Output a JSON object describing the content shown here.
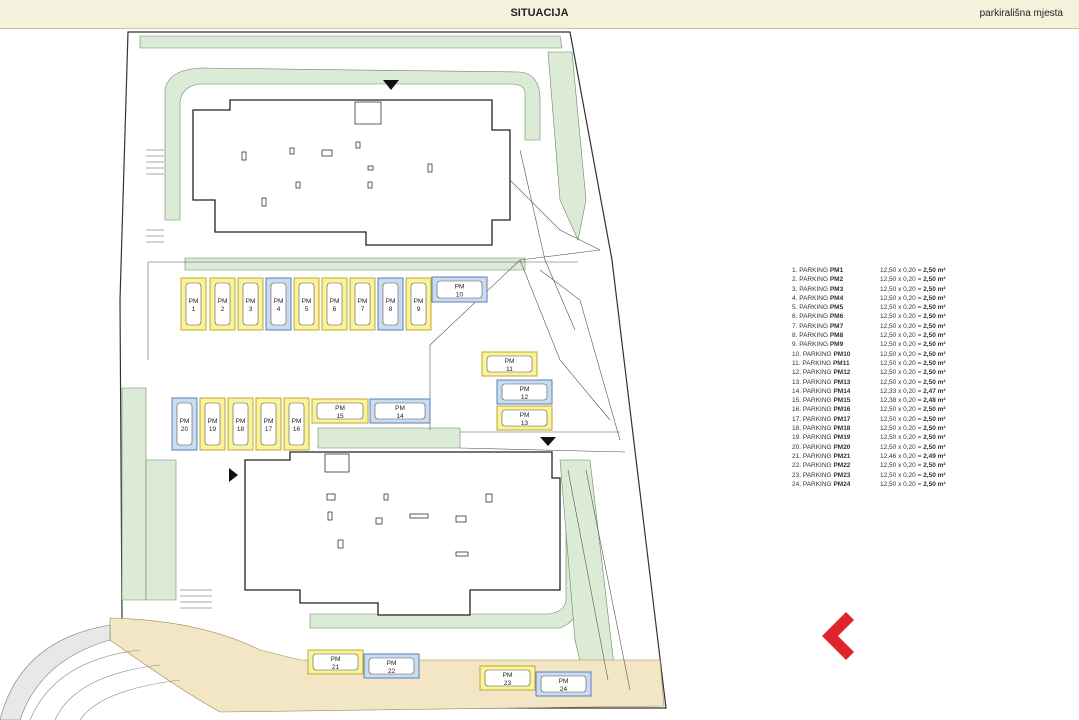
{
  "header": {
    "title": "SITUACIJA",
    "subtitle": "parkirališna mjesta"
  },
  "colors": {
    "green": "#dcebd6",
    "sand": "#f2e6c4",
    "yellow_bay": "#fbf39a",
    "blue_bay": "#c9dcf0",
    "yellow_border": "#b8a93a",
    "blue_border": "#5b7fb6",
    "brand_red": "#e0242c"
  },
  "icons": {
    "logo": "red-chevron-left-icon",
    "entrance": "triangle-marker-icon"
  },
  "bays": [
    {
      "num": "1",
      "color": "yellow"
    },
    {
      "num": "2",
      "color": "yellow"
    },
    {
      "num": "3",
      "color": "yellow"
    },
    {
      "num": "4",
      "color": "blue"
    },
    {
      "num": "5",
      "color": "yellow"
    },
    {
      "num": "6",
      "color": "yellow"
    },
    {
      "num": "7",
      "color": "yellow"
    },
    {
      "num": "8",
      "color": "blue"
    },
    {
      "num": "9",
      "color": "yellow"
    },
    {
      "num": "10",
      "color": "blue"
    },
    {
      "num": "11",
      "color": "yellow"
    },
    {
      "num": "12",
      "color": "blue"
    },
    {
      "num": "13",
      "color": "yellow"
    },
    {
      "num": "14",
      "color": "blue"
    },
    {
      "num": "15",
      "color": "yellow"
    },
    {
      "num": "16",
      "color": "yellow"
    },
    {
      "num": "17",
      "color": "yellow"
    },
    {
      "num": "18",
      "color": "yellow"
    },
    {
      "num": "19",
      "color": "yellow"
    },
    {
      "num": "20",
      "color": "blue"
    },
    {
      "num": "21",
      "color": "yellow"
    },
    {
      "num": "22",
      "color": "blue"
    },
    {
      "num": "23",
      "color": "yellow"
    },
    {
      "num": "24",
      "color": "blue"
    }
  ],
  "bay_prefix": "PM",
  "legend": [
    {
      "index": "1.",
      "name": "PARKING",
      "code": "PM1",
      "dims": "12,50 x 0,20 =",
      "area": "2,50 m²"
    },
    {
      "index": "2.",
      "name": "PARKING",
      "code": "PM2",
      "dims": "12,50 x 0,20 =",
      "area": "2,50 m²"
    },
    {
      "index": "3.",
      "name": "PARKING",
      "code": "PM3",
      "dims": "12,50 x 0,20 =",
      "area": "2,50 m²"
    },
    {
      "index": "4.",
      "name": "PARKING",
      "code": "PM4",
      "dims": "12,50 x 0,20 =",
      "area": "2,50 m²"
    },
    {
      "index": "5.",
      "name": "PARKING",
      "code": "PM5",
      "dims": "12,50 x 0,20 =",
      "area": "2,50 m²"
    },
    {
      "index": "6.",
      "name": "PARKING",
      "code": "PM6",
      "dims": "12,50 x 0,20 =",
      "area": "2,50 m²"
    },
    {
      "index": "7.",
      "name": "PARKING",
      "code": "PM7",
      "dims": "12,50 x 0,20 =",
      "area": "2,50 m²"
    },
    {
      "index": "8.",
      "name": "PARKING",
      "code": "PM8",
      "dims": "12,50 x 0,20 =",
      "area": "2,50 m²"
    },
    {
      "index": "9.",
      "name": "PARKING",
      "code": "PM9",
      "dims": "12,50 x 0,20 =",
      "area": "2,50 m²"
    },
    {
      "index": "10.",
      "name": "PARKING",
      "code": "PM10",
      "dims": "12,50 x 0,20 =",
      "area": "2,50 m²"
    },
    {
      "index": "11.",
      "name": "PARKING",
      "code": "PM11",
      "dims": "12,50 x 0,20 =",
      "area": "2,50 m²"
    },
    {
      "index": "12.",
      "name": "PARKING",
      "code": "PM12",
      "dims": "12,50 x 0,20 =",
      "area": "2,50 m²"
    },
    {
      "index": "13.",
      "name": "PARKING",
      "code": "PM13",
      "dims": "12,50 x 0,20 =",
      "area": "2,50 m²"
    },
    {
      "index": "14.",
      "name": "PARKING",
      "code": "PM14",
      "dims": "12,33 x 0,20 =",
      "area": "2,47 m²"
    },
    {
      "index": "15.",
      "name": "PARKING",
      "code": "PM15",
      "dims": "12,38 x 0,20 =",
      "area": "2,48 m²"
    },
    {
      "index": "16.",
      "name": "PARKING",
      "code": "PM16",
      "dims": "12,50 x 0,20 =",
      "area": "2,50 m²"
    },
    {
      "index": "17.",
      "name": "PARKING",
      "code": "PM17",
      "dims": "12,50 x 0,20 =",
      "area": "2,50 m²"
    },
    {
      "index": "18.",
      "name": "PARKING",
      "code": "PM18",
      "dims": "12,50 x 0,20 =",
      "area": "2,50 m²"
    },
    {
      "index": "19.",
      "name": "PARKING",
      "code": "PM19",
      "dims": "12,50 x 0,20 =",
      "area": "2,50 m²"
    },
    {
      "index": "20.",
      "name": "PARKING",
      "code": "PM20",
      "dims": "12,50 x 0,20 =",
      "area": "2,50 m²"
    },
    {
      "index": "21.",
      "name": "PARKING",
      "code": "PM21",
      "dims": "12,46 x 0,20 =",
      "area": "2,49 m²"
    },
    {
      "index": "22.",
      "name": "PARKING",
      "code": "PM22",
      "dims": "12,50 x 0,20 =",
      "area": "2,50 m²"
    },
    {
      "index": "23.",
      "name": "PARKING",
      "code": "PM23",
      "dims": "12,50 x 0,20 =",
      "area": "2,50 m²"
    },
    {
      "index": "24.",
      "name": "PARKING",
      "code": "PM24",
      "dims": "12,50 x 0,20 =",
      "area": "2,50 m²"
    }
  ]
}
